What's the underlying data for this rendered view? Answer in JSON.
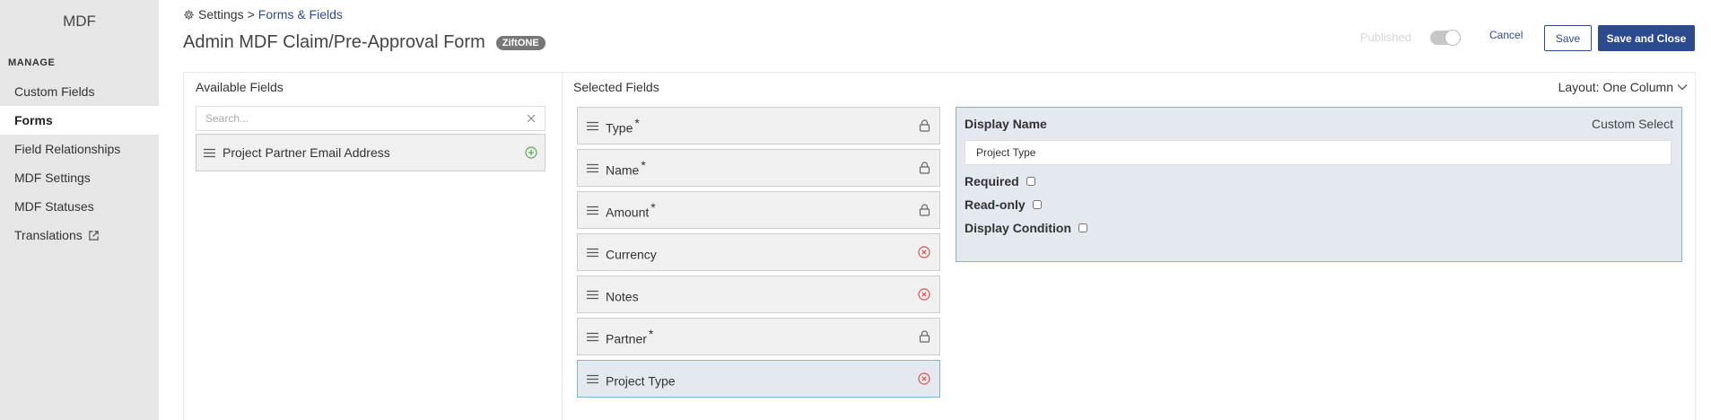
{
  "sidebar": {
    "app_title": "MDF",
    "section_label": "MANAGE",
    "items": [
      {
        "label": "Custom Fields",
        "active": false
      },
      {
        "label": "Forms",
        "active": true
      },
      {
        "label": "Field Relationships",
        "active": false
      },
      {
        "label": "MDF Settings",
        "active": false
      },
      {
        "label": "MDF Statuses",
        "active": false
      },
      {
        "label": "Translations",
        "active": false,
        "icon": "external-link-icon"
      }
    ]
  },
  "header": {
    "breadcrumb_root": "Settings",
    "breadcrumb_sep": ">",
    "breadcrumb_current": "Forms & Fields",
    "title": "Admin MDF Claim/Pre-Approval Form",
    "badge": "ZiftONE",
    "published_label": "Published",
    "published_on": true,
    "cancel_label": "Cancel",
    "save_label": "Save",
    "save_close_label": "Save and Close"
  },
  "available": {
    "label": "Available Fields",
    "search_placeholder": "Search...",
    "items": [
      {
        "label": "Project Partner Email Address"
      }
    ]
  },
  "selected": {
    "label": "Selected Fields",
    "layout_label": "Layout: One Column",
    "fields": [
      {
        "label": "Type",
        "required": "*",
        "icon": "lock-icon"
      },
      {
        "label": "Name",
        "required": "*",
        "icon": "lock-icon"
      },
      {
        "label": "Amount",
        "required": "*",
        "icon": "lock-icon"
      },
      {
        "label": "Currency",
        "required": "",
        "icon": "remove-icon"
      },
      {
        "label": "Notes",
        "required": "",
        "icon": "remove-icon"
      },
      {
        "label": "Partner",
        "required": "*",
        "icon": "lock-icon"
      },
      {
        "label": "Project Type",
        "required": "",
        "icon": "remove-icon",
        "selected": true
      }
    ]
  },
  "detail": {
    "display_name_label": "Display Name",
    "type_label": "Custom Select",
    "display_name_value": "Project Type",
    "required_label": "Required",
    "readonly_label": "Read-only",
    "condition_label": "Display Condition"
  },
  "colors": {
    "primary": "#2e4a8f",
    "sidebar_bg": "#e6e6e6",
    "selected_bg": "#e3e9ef",
    "selected_border": "#79b6d6",
    "remove_red": "#d9534f",
    "add_green": "#4caf50"
  }
}
